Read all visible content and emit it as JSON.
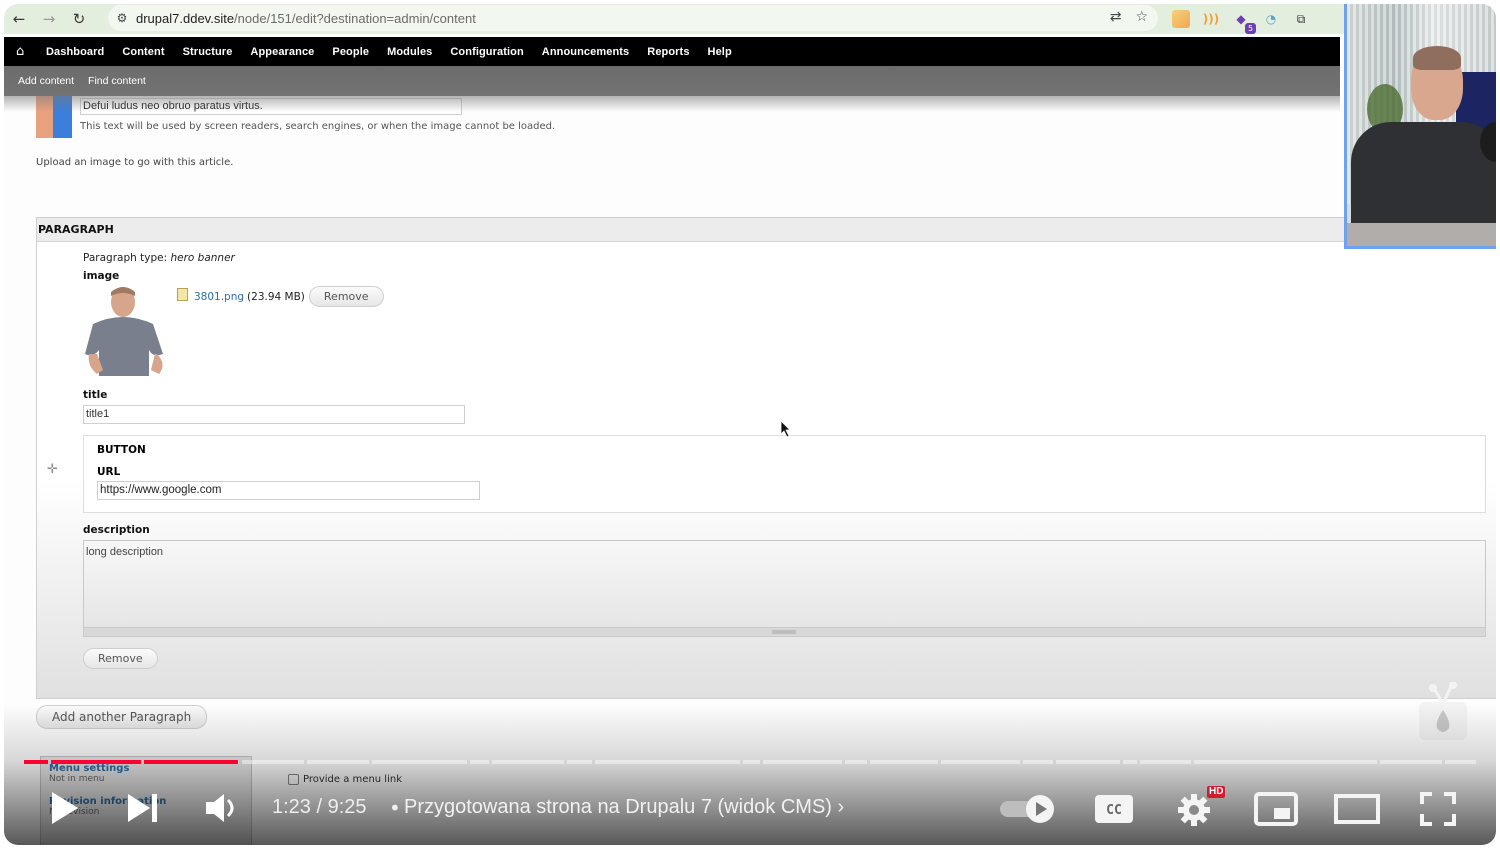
{
  "browser": {
    "url_host": "drupal7.ddev.site",
    "url_path": "/node/151/edit?destination=admin/content",
    "icons": [
      "back-icon",
      "forward-icon",
      "reload-icon",
      "site-info-icon",
      "translate-icon",
      "bookmark-star-icon"
    ],
    "extensions": [
      "ext-yellow-icon",
      "ext-rss-icon",
      "ext-purple-icon",
      "ext-gauge-icon",
      "extensions-puzzle-icon"
    ],
    "ext_badge": "5"
  },
  "admin_menu": {
    "items": [
      "Dashboard",
      "Content",
      "Structure",
      "Appearance",
      "People",
      "Modules",
      "Configuration",
      "Announcements",
      "Reports",
      "Help"
    ]
  },
  "shortcuts": {
    "items": [
      "Add content",
      "Find content"
    ]
  },
  "image_field": {
    "alt_value": "Defui ludus neo obruo paratus virtus.",
    "alt_help": "This text will be used by screen readers, search engines, or when the image cannot be loaded.",
    "upload_help": "Upload an image to go with this article."
  },
  "paragraph": {
    "legend": "PARAGRAPH",
    "type_label": "Paragraph type:",
    "type_value": "hero banner",
    "image_label": "image",
    "file_name": "3801.png",
    "file_size": "(23.94 MB)",
    "file_remove": "Remove",
    "title_label": "title",
    "title_value": "title1",
    "button_heading": "BUTTON",
    "url_label": "URL",
    "url_value": "https://www.google.com",
    "description_label": "description",
    "description_value": "long description",
    "remove_label": "Remove"
  },
  "add_another": "Add another Paragraph",
  "vertical_tabs": [
    {
      "title": "Menu settings",
      "summary": "Not in menu"
    },
    {
      "title": "Revision information",
      "summary": "No revision"
    }
  ],
  "menu_link_checkbox": {
    "label": "Provide a menu link",
    "checked": false
  },
  "video_player": {
    "current_time": "1:23",
    "duration": "9:25",
    "time_separator": "/",
    "chapter_title": "Przygotowana strona na Drupalu 7 (widok CMS)",
    "progress_fraction": 0.147,
    "quality_badge": "HD",
    "autoplay_on": true,
    "chapter_segments_fraction": [
      0.02,
      0.068,
      0.071,
      0.048,
      0.047,
      0.072,
      0.016,
      0.055,
      0.02,
      0.108,
      0.015,
      0.06,
      0.018,
      0.052,
      0.06,
      0.024,
      0.049,
      0.012,
      0.04,
      0.136,
      0.047,
      0.025
    ]
  },
  "channel_watermark": "drupal-tv-icon"
}
